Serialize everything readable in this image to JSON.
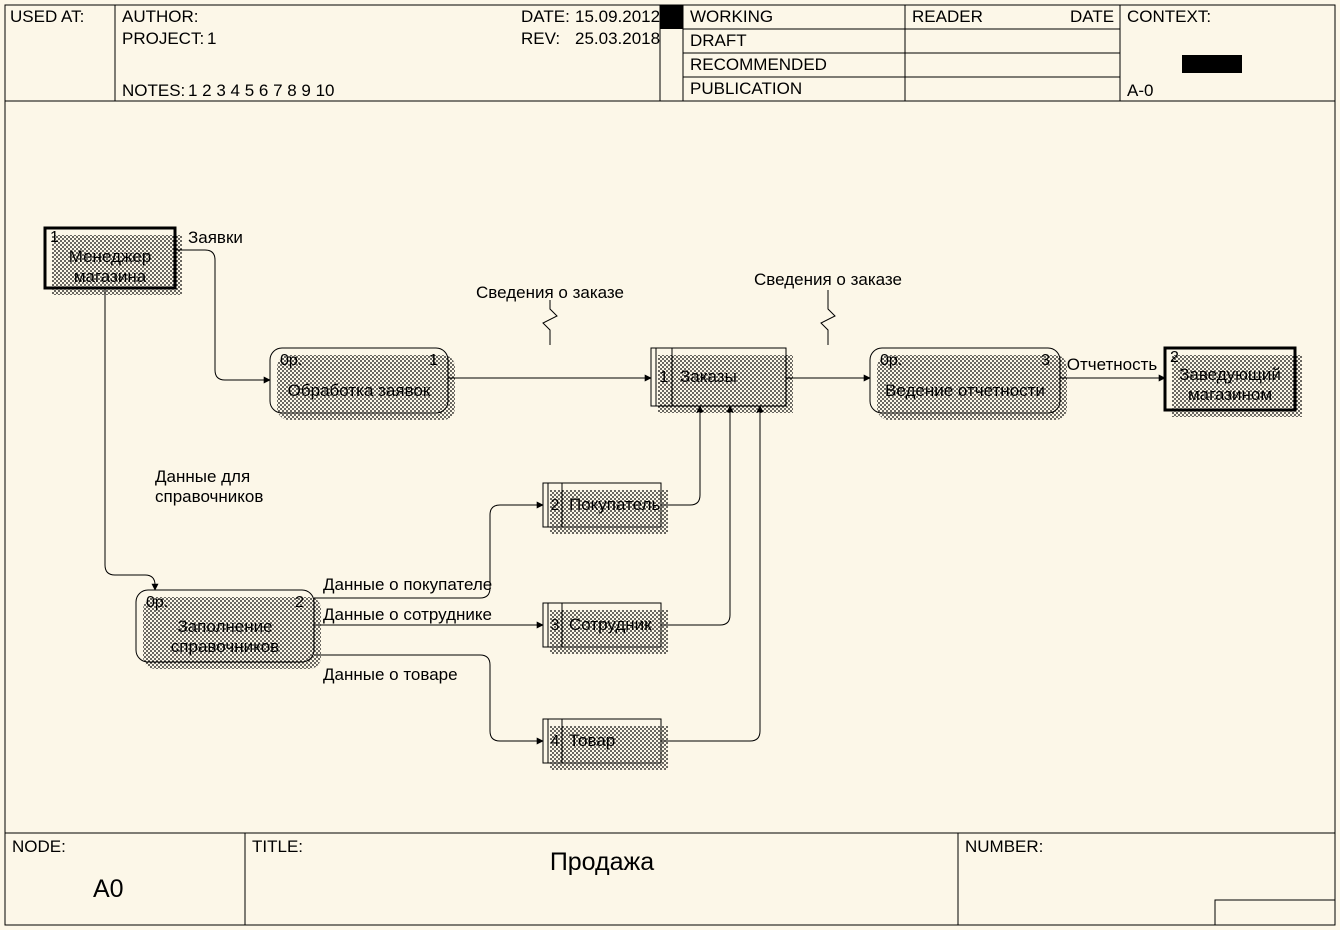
{
  "header": {
    "used_at": "USED AT:",
    "author": "AUTHOR:",
    "project_label": "PROJECT:",
    "project_value": "1",
    "date_label": "DATE:",
    "date_value": "15.09.2012",
    "rev_label": "REV:",
    "rev_value": "25.03.2018",
    "notes_label": "NOTES:",
    "notes_value": "1  2  3  4  5  6  7  8  9  10",
    "working": "WORKING",
    "draft": "DRAFT",
    "recommended": "RECOMMENDED",
    "publication": "PUBLICATION",
    "reader": "READER",
    "date2": "DATE",
    "context": "CONTEXT:",
    "context_node": "A-0"
  },
  "footer": {
    "node_label": "NODE:",
    "node_value": "A0",
    "title_label": "TITLE:",
    "title_value": "Продажа",
    "number_label": "NUMBER:"
  },
  "diagram": {
    "ext1_num": "1",
    "ext1_l1": "Менеджер",
    "ext1_l2": "магазина",
    "ext2_num": "2",
    "ext2_l1": "Заведующий",
    "ext2_l2": "магазином",
    "p1_tag": "0р.",
    "p1_num": "1",
    "p1_title": "Обработка заявок",
    "p2_tag": "0р.",
    "p2_num": "2",
    "p2_l1": "Заполнение",
    "p2_l2": "справочников",
    "p3_tag": "0р.",
    "p3_num": "3",
    "p3_title": "Ведение отчетности",
    "ds1_num": "1",
    "ds1_title": "Заказы",
    "ds2_num": "2",
    "ds2_title": "Покупатель",
    "ds3_num": "3",
    "ds3_title": "Сотрудник",
    "ds4_num": "4",
    "ds4_title": "Товар",
    "f_requests": "Заявки",
    "f_refdata_l1": "Данные для",
    "f_refdata_l2": "справочников",
    "f_order_info_1": "Сведения о заказе",
    "f_order_info_2": "Сведения о заказе",
    "f_reporting": "Отчетность",
    "f_buyer": "Данные о покупателе",
    "f_employee": "Данные о сотруднике",
    "f_goods": "Данные о товаре"
  }
}
